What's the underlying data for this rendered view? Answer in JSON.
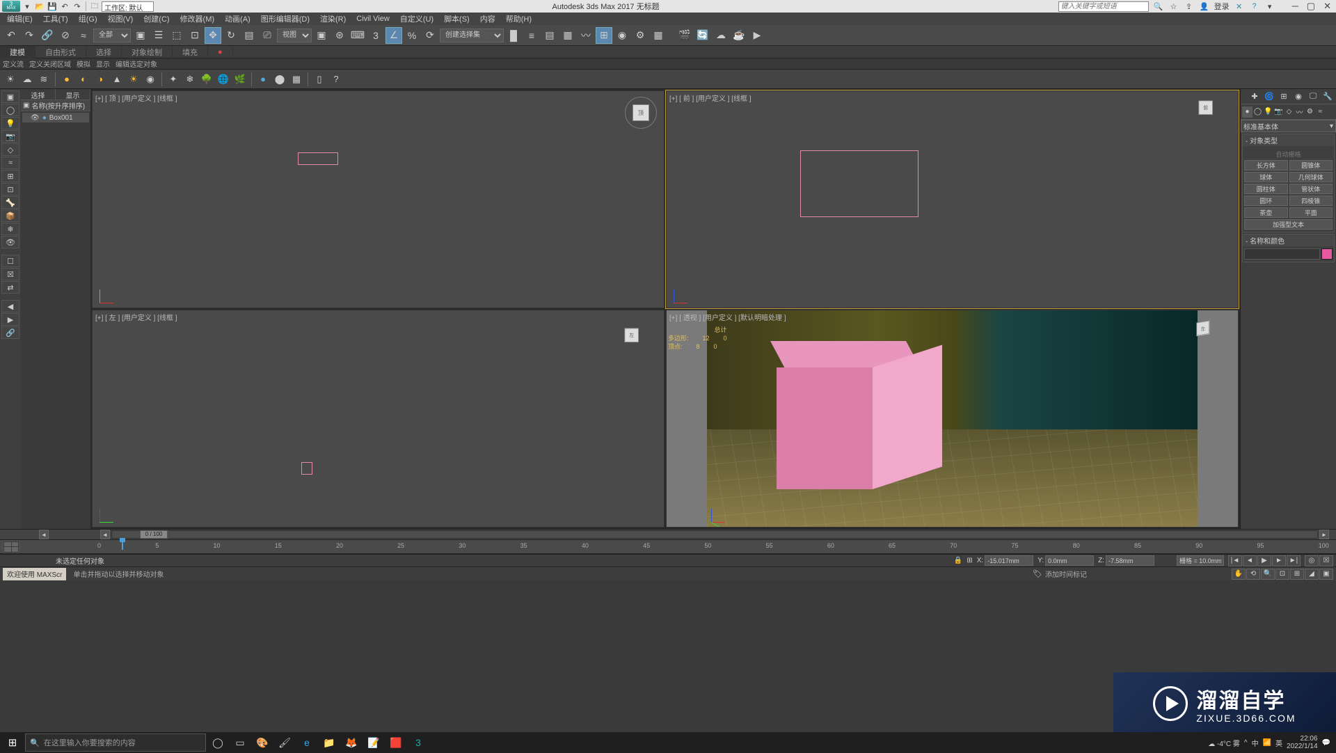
{
  "title_bar": {
    "workspace_label": "工作区: 默认",
    "app_title": "Autodesk 3ds Max 2017    无标题",
    "search_placeholder": "键入关键字或短语",
    "login": "登录"
  },
  "menu": {
    "edit": "编辑(E)",
    "tools": "工具(T)",
    "group": "组(G)",
    "views": "视图(V)",
    "create": "创建(C)",
    "modifiers": "修改器(M)",
    "animation": "动画(A)",
    "graph_editors": "图形编辑器(D)",
    "rendering": "渲染(R)",
    "civil_view": "Civil View",
    "customize": "自定义(U)",
    "scripting": "脚本(S)",
    "content": "内容",
    "help": "帮助(H)"
  },
  "main_toolbar": {
    "sel_filter": "全部",
    "named_sel": "创建选择集"
  },
  "ribbon": {
    "tabs": [
      "建模",
      "自由形式",
      "选择",
      "对象绘制",
      "填充"
    ],
    "sub": [
      "定义流",
      "定义关闭区域",
      "模拟",
      "显示",
      "编辑选定对象"
    ]
  },
  "scene": {
    "tab1": "选择",
    "tab2": "显示",
    "header": "名称(按升序排序)",
    "item1": "Box001"
  },
  "viewports": {
    "top": "[+] [ 顶 ] [用户定义 ] [线框 ]",
    "front": "[+] [ 前 ] [用户定义 ] [线框 ]",
    "left": "[+] [ 左 ] [用户定义 ] [线框 ]",
    "persp": "[+] [ 透视 ] [用户定义 ] [默认明暗处理 ]",
    "stats_title": "总计",
    "stats_poly_lbl": "多边形:",
    "stats_poly": "12",
    "stats_poly2": "0",
    "stats_vert_lbl": "顶点:",
    "stats_vert": "8",
    "stats_vert2": "0"
  },
  "command_panel": {
    "category": "标准基本体",
    "obj_type_header": "对象类型",
    "auto_grid": "自动栅格",
    "buttons": {
      "box": "长方体",
      "cone": "圆锥体",
      "sphere": "球体",
      "geosphere": "几何球体",
      "cylinder": "圆柱体",
      "tube": "管状体",
      "torus": "圆环",
      "pyramid": "四棱锥",
      "teapot": "茶壶",
      "plane": "平面",
      "textplus": "加强型文本"
    },
    "name_color_header": "名称和颜色"
  },
  "timeline": {
    "scrub_label": "0 / 100",
    "ticks": [
      "0",
      "5",
      "10",
      "15",
      "20",
      "25",
      "30",
      "35",
      "40",
      "45",
      "50",
      "55",
      "60",
      "65",
      "70",
      "75",
      "80",
      "85",
      "90",
      "95",
      "100"
    ]
  },
  "status": {
    "no_sel": "未选定任何对象",
    "x_lbl": "X:",
    "x_val": "-15.017mm",
    "y_lbl": "Y:",
    "y_val": "0.0mm",
    "z_lbl": "Z:",
    "z_val": "-7.58mm",
    "grid": "栅格 = 10.0mm",
    "tag": "添加时间标记",
    "prompt": "单击并拖动以选择并移动对象",
    "welcome": "欢迎使用 MAXScr"
  },
  "watermark": {
    "cn": "溜溜自学",
    "url": "ZIXUE.3D66.COM"
  },
  "taskbar": {
    "search_placeholder": "在这里输入你要搜索的内容",
    "weather": "-4°C 雾",
    "ime": "英",
    "cn": "中",
    "time": "22:06",
    "date": "2022/1/14"
  }
}
